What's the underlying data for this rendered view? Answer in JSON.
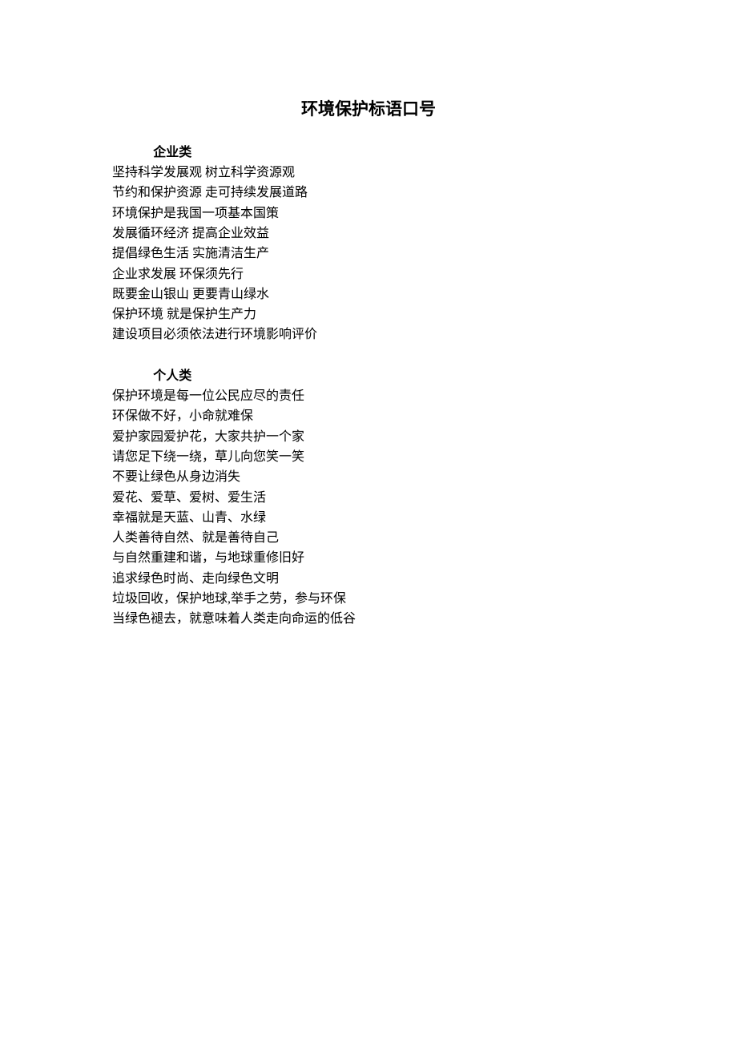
{
  "title": "环境保护标语口号",
  "sections": [
    {
      "heading": "企业类",
      "lines": [
        "坚持科学发展观 树立科学资源观",
        "节约和保护资源 走可持续发展道路",
        "环境保护是我国一项基本国策",
        "发展循环经济 提高企业效益",
        "提倡绿色生活 实施清洁生产",
        "企业求发展 环保须先行",
        "既要金山银山 更要青山绿水",
        "保护环境 就是保护生产力",
        "建设项目必须依法进行环境影响评价"
      ]
    },
    {
      "heading": "个人类",
      "lines": [
        "保护环境是每一位公民应尽的责任",
        "环保做不好，小命就难保",
        "爱护家园爱护花，大家共护一个家",
        "请您足下绕一绕，草儿向您笑一笑",
        "不要让绿色从身边消失",
        "爱花、爱草、爱树、爱生活",
        "幸福就是天蓝、山青、水绿",
        "人类善待自然、就是善待自己",
        "与自然重建和谐，与地球重修旧好",
        "追求绿色时尚、走向绿色文明",
        "垃圾回收，保护地球,举手之劳，参与环保",
        "当绿色褪去，就意味着人类走向命运的低谷"
      ]
    }
  ]
}
